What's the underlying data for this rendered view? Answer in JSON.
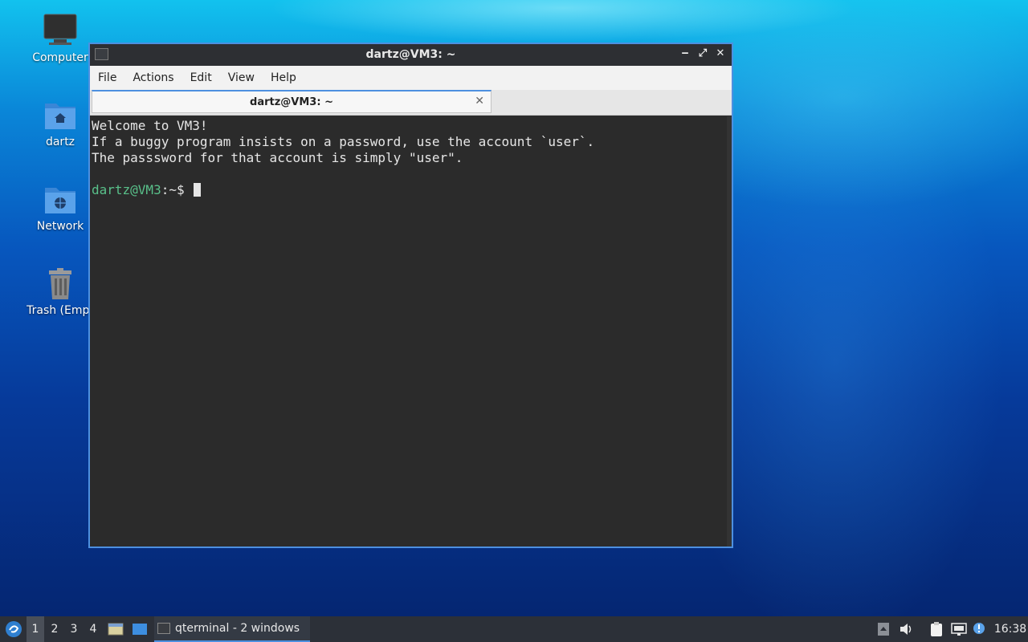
{
  "desktop": {
    "icons": [
      {
        "label": "Computer",
        "icon": "computer-icon"
      },
      {
        "label": "dartz",
        "icon": "home-folder-icon"
      },
      {
        "label": "Network",
        "icon": "network-folder-icon"
      },
      {
        "label": "Trash (Empt",
        "icon": "trash-icon"
      }
    ]
  },
  "window": {
    "title": "dartz@VM3: ~",
    "controls": {
      "minimize": "‒",
      "maximize": "⤢",
      "close": "✕"
    },
    "menu": [
      "File",
      "Actions",
      "Edit",
      "View",
      "Help"
    ],
    "tab": {
      "label": "dartz@VM3: ~",
      "close": "✕"
    },
    "terminal": {
      "lines": [
        "Welcome to VM3!",
        "If a buggy program insists on a password, use the account `user`.",
        "The passsword for that account is simply \"user\"."
      ],
      "prompt_user": "dartz@VM3",
      "prompt_rest": ":~$ "
    }
  },
  "taskbar": {
    "workspaces": [
      "1",
      "2",
      "3",
      "4"
    ],
    "task_label": "qterminal - 2 windows",
    "clock": "16:38"
  },
  "colors": {
    "accent": "#4d90e0",
    "prompt_green": "#59c08a",
    "terminal_bg": "#2b2b2b",
    "taskbar_bg": "#2c3038"
  }
}
